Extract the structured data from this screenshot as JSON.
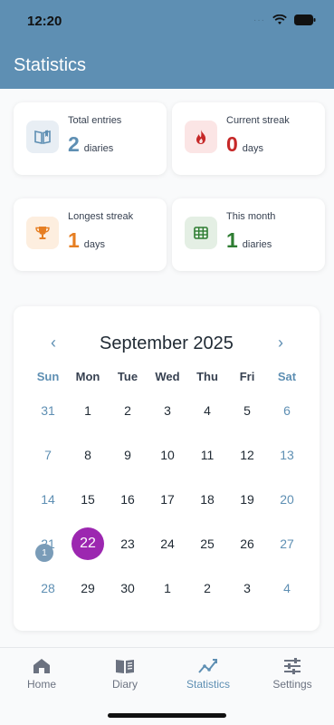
{
  "status": {
    "time": "12:20",
    "dots": "···"
  },
  "header": {
    "title": "Statistics"
  },
  "stats": [
    {
      "label": "Total entries",
      "value": "2",
      "unit": "diaries",
      "color": "#5e8fb3",
      "icon": "book-icon"
    },
    {
      "label": "Current streak",
      "value": "0",
      "unit": "days",
      "color": "#c62828",
      "icon": "fire-icon"
    },
    {
      "label": "Longest streak",
      "value": "1",
      "unit": "days",
      "color": "#e67e22",
      "icon": "trophy-icon"
    },
    {
      "label": "This month",
      "value": "1",
      "unit": "diaries",
      "color": "#2e7d32",
      "icon": "grid-calendar-icon"
    }
  ],
  "calendar": {
    "title": "September 2025",
    "prev": "‹",
    "next": "›",
    "weekdays": [
      "Sun",
      "Mon",
      "Tue",
      "Wed",
      "Thu",
      "Fri",
      "Sat"
    ],
    "weeks": [
      [
        "31",
        "1",
        "2",
        "3",
        "4",
        "5",
        "6"
      ],
      [
        "7",
        "8",
        "9",
        "10",
        "11",
        "12",
        "13"
      ],
      [
        "14",
        "15",
        "16",
        "17",
        "18",
        "19",
        "20"
      ],
      [
        "21",
        "22",
        "23",
        "24",
        "25",
        "26",
        "27"
      ],
      [
        "28",
        "29",
        "30",
        "1",
        "2",
        "3",
        "4"
      ]
    ],
    "selected_day": "22",
    "marked_day": "21",
    "marked_count": "1",
    "accent": "#9c27b0"
  },
  "tabs": [
    {
      "label": "Home",
      "icon": "home-icon",
      "active": false
    },
    {
      "label": "Diary",
      "icon": "diary-icon",
      "active": false
    },
    {
      "label": "Statistics",
      "icon": "chart-icon",
      "active": true
    },
    {
      "label": "Settings",
      "icon": "sliders-icon",
      "active": false
    }
  ]
}
